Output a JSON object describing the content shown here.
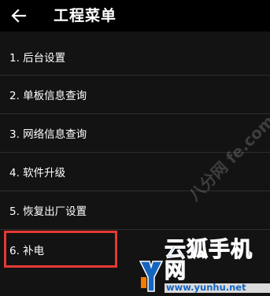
{
  "header": {
    "title": "工程菜单",
    "back_icon": "arrow-left-icon"
  },
  "menu": {
    "items": [
      {
        "label": "1. 后台设置"
      },
      {
        "label": "2. 单板信息查询"
      },
      {
        "label": "3. 网络信息查询"
      },
      {
        "label": "4. 软件升级"
      },
      {
        "label": "5. 恢复出厂设置"
      },
      {
        "label": "6. 补电"
      }
    ]
  },
  "watermark": {
    "main": "云狐手机网",
    "url": "www.yunhu.net",
    "faint": "八分网 fe.com"
  },
  "colors": {
    "background": "#131313",
    "header": "#000000",
    "highlight": "#e53935",
    "watermark": "#1565c0"
  }
}
